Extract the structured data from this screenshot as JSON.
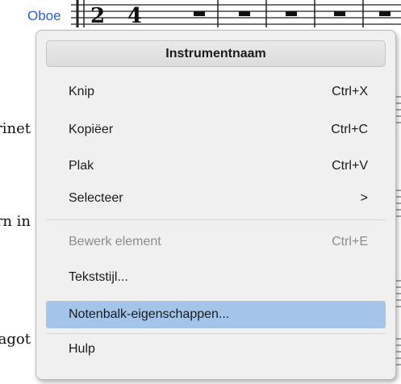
{
  "score": {
    "instrument_labels": [
      "Oboe",
      "Klarinet",
      "Hoorn in",
      "Fagot"
    ]
  },
  "context_menu": {
    "header": "Instrumentnaam",
    "items": [
      {
        "label": "Knip",
        "shortcut": "Ctrl+X",
        "enabled": true
      },
      {
        "label": "Kopiëer",
        "shortcut": "Ctrl+C",
        "enabled": true
      },
      {
        "label": "Plak",
        "shortcut": "Ctrl+V",
        "enabled": true
      },
      {
        "label": "Selecteer",
        "submenu_arrow": ">",
        "enabled": true
      },
      {
        "label": "Bewerk element",
        "shortcut": "Ctrl+E",
        "enabled": false
      },
      {
        "label": "Tekststijl...",
        "enabled": true
      },
      {
        "label": "Notenbalk-eigenschappen...",
        "enabled": true,
        "highlighted": true
      },
      {
        "label": "Hulp",
        "enabled": true
      }
    ]
  },
  "colors": {
    "menu_background": "#f0f0f0",
    "highlight": "#a4c4ea",
    "disabled_text": "#8c8c8c",
    "instrument_name_selected": "#2f5fc7"
  }
}
